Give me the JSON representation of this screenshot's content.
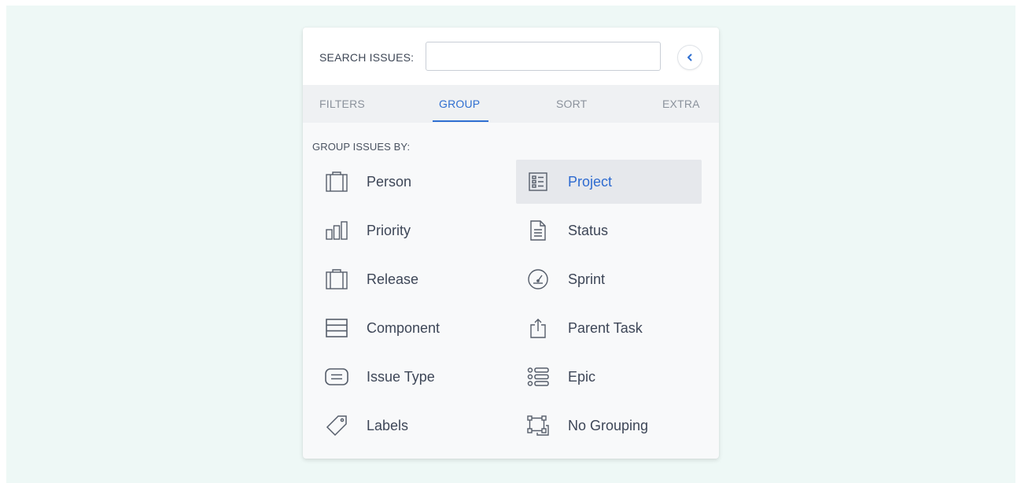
{
  "search": {
    "label": "SEARCH ISSUES:",
    "value": "",
    "placeholder": ""
  },
  "collapse_button": {
    "icon": "chevron-left-icon",
    "color": "#2f6fd1"
  },
  "tabs": [
    {
      "label": "FILTERS",
      "active": false
    },
    {
      "label": "GROUP",
      "active": true
    },
    {
      "label": "SORT",
      "active": false
    },
    {
      "label": "EXTRA",
      "active": false
    }
  ],
  "group": {
    "heading": "GROUP ISSUES BY:",
    "items": [
      {
        "label": "Person",
        "icon": "briefcase-icon",
        "selected": false
      },
      {
        "label": "Project",
        "icon": "project-list-icon",
        "selected": true
      },
      {
        "label": "Priority",
        "icon": "bar-chart-icon",
        "selected": false
      },
      {
        "label": "Status",
        "icon": "document-icon",
        "selected": false
      },
      {
        "label": "Release",
        "icon": "briefcase-icon",
        "selected": false
      },
      {
        "label": "Sprint",
        "icon": "speedometer-icon",
        "selected": false
      },
      {
        "label": "Component",
        "icon": "stacked-rows-icon",
        "selected": false
      },
      {
        "label": "Parent Task",
        "icon": "share-upload-icon",
        "selected": false
      },
      {
        "label": "Issue Type",
        "icon": "message-box-icon",
        "selected": false
      },
      {
        "label": "Epic",
        "icon": "list-bullets-icon",
        "selected": false
      },
      {
        "label": "Labels",
        "icon": "tag-icon",
        "selected": false
      },
      {
        "label": "No Grouping",
        "icon": "ungroup-icon",
        "selected": false
      }
    ]
  },
  "colors": {
    "accent": "#2f6fd1",
    "background": "#eef8f6",
    "selected_row": "#e6e8ec"
  }
}
